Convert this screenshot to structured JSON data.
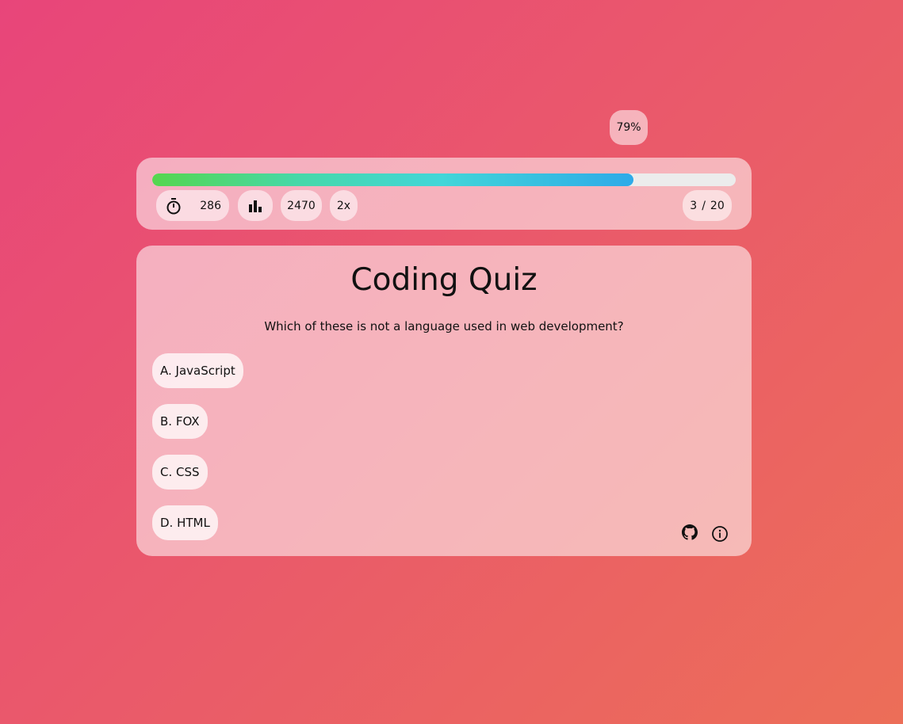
{
  "progress": {
    "percent_label": "79%",
    "fraction": 0.825
  },
  "stats": {
    "timer_icon": "stopwatch-icon",
    "timer_value": "286",
    "chart_icon": "bar-chart-icon",
    "score": "2470",
    "multiplier": "2x",
    "current_question": "3",
    "separator": "/",
    "total_questions": "20"
  },
  "quiz": {
    "title": "Coding Quiz",
    "question": "Which of these is not a language used in web development?",
    "answers": [
      {
        "label": "A. JavaScript"
      },
      {
        "label": "B. FOX"
      },
      {
        "label": "C. CSS"
      },
      {
        "label": "D. HTML"
      }
    ]
  },
  "footer": {
    "icons": [
      "github-icon",
      "info-icon"
    ]
  },
  "colors": {
    "background_start": "#e8457a",
    "background_end": "#ec6e58",
    "progress_start": "#56d64e",
    "progress_end": "#2eaae8"
  }
}
